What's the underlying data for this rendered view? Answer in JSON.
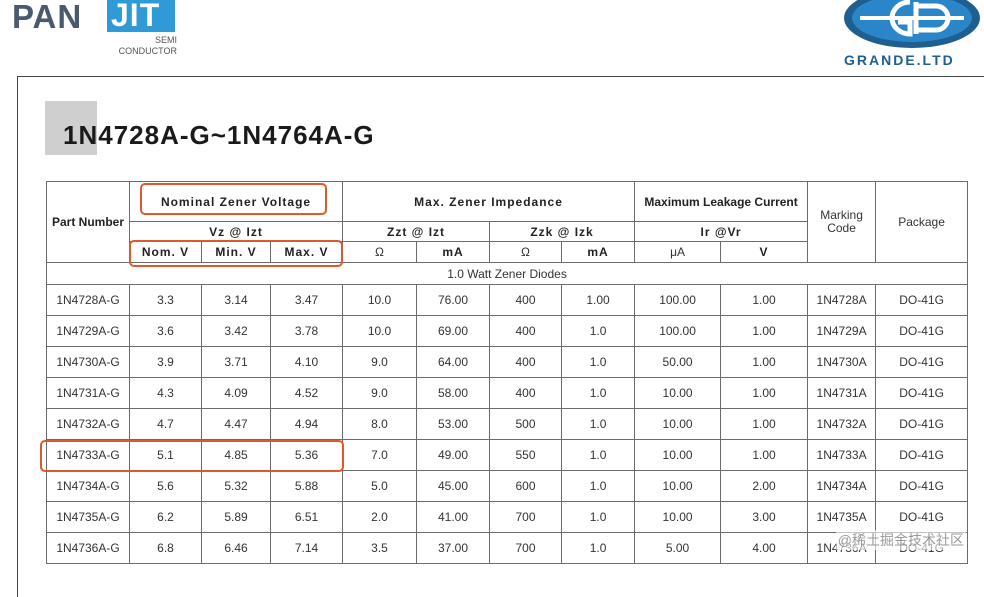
{
  "brand_left": {
    "main": "PAN",
    "accent": "JIT",
    "sub": [
      "SEMI",
      "CONDUCTOR"
    ]
  },
  "brand_right": {
    "name": "GRANDE.LTD"
  },
  "title": "1N4728A-G~1N4764A-G",
  "header": {
    "part_number": "Part Number",
    "nominal": "Nominal Zener Voltage",
    "impedance": "Max. Zener Impedance",
    "leakage": "Maximum Leakage Current",
    "marking": "Marking\nCode",
    "package": "Package",
    "vz_cond": "Vz @ Izt",
    "zzt_cond": "Zzt @ Izt",
    "zzk_cond": "Zzk @ Izk",
    "ir_cond": "Ir @Vr",
    "units": [
      "Nom. V",
      "Min. V",
      "Max. V",
      "Ω",
      "mA",
      "Ω",
      "mA",
      "μA",
      "V"
    ]
  },
  "section_label": "1.0 Watt Zener Diodes",
  "rows": [
    [
      "1N4728A-G",
      "3.3",
      "3.14",
      "3.47",
      "10.0",
      "76.00",
      "400",
      "1.00",
      "100.00",
      "1.00",
      "1N4728A",
      "DO-41G"
    ],
    [
      "1N4729A-G",
      "3.6",
      "3.42",
      "3.78",
      "10.0",
      "69.00",
      "400",
      "1.0",
      "100.00",
      "1.00",
      "1N4729A",
      "DO-41G"
    ],
    [
      "1N4730A-G",
      "3.9",
      "3.71",
      "4.10",
      "9.0",
      "64.00",
      "400",
      "1.0",
      "50.00",
      "1.00",
      "1N4730A",
      "DO-41G"
    ],
    [
      "1N4731A-G",
      "4.3",
      "4.09",
      "4.52",
      "9.0",
      "58.00",
      "400",
      "1.0",
      "10.00",
      "1.00",
      "1N4731A",
      "DO-41G"
    ],
    [
      "1N4732A-G",
      "4.7",
      "4.47",
      "4.94",
      "8.0",
      "53.00",
      "500",
      "1.0",
      "10.00",
      "1.00",
      "1N4732A",
      "DO-41G"
    ],
    [
      "1N4733A-G",
      "5.1",
      "4.85",
      "5.36",
      "7.0",
      "49.00",
      "550",
      "1.0",
      "10.00",
      "1.00",
      "1N4733A",
      "DO-41G"
    ],
    [
      "1N4734A-G",
      "5.6",
      "5.32",
      "5.88",
      "5.0",
      "45.00",
      "600",
      "1.0",
      "10.00",
      "2.00",
      "1N4734A",
      "DO-41G"
    ],
    [
      "1N4735A-G",
      "6.2",
      "5.89",
      "6.51",
      "2.0",
      "41.00",
      "700",
      "1.0",
      "10.00",
      "3.00",
      "1N4735A",
      "DO-41G"
    ],
    [
      "1N4736A-G",
      "6.8",
      "6.46",
      "7.14",
      "3.5",
      "37.00",
      "700",
      "1.0",
      "5.00",
      "4.00",
      "1N4736A",
      "DO-41G"
    ]
  ],
  "watermark": "@稀土掘金技术社区",
  "colors": {
    "highlight": "#e2572b",
    "jit_blue": "#2e9bd6",
    "grande_blue": "#1e5f8f"
  }
}
